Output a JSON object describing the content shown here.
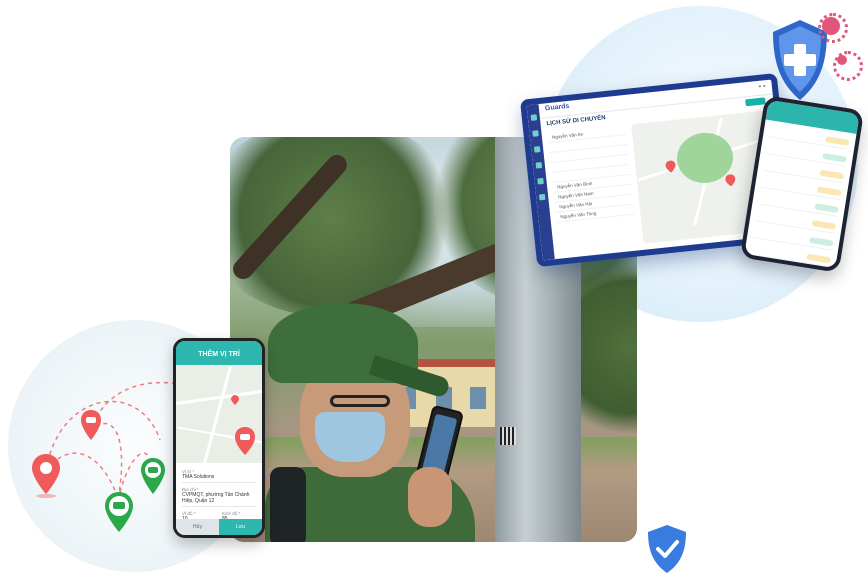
{
  "colors": {
    "brand_teal": "#2db7ae",
    "brand_navy": "#1e3b8f",
    "shield_blue": "#3a7be0",
    "pin_red": "#ef5a5a",
    "pin_green": "#2aa84a"
  },
  "photo": {
    "description_icon": "person-with-phone-photo"
  },
  "dashboard": {
    "logo": "Guards",
    "title": "LỊCH SỬ DI CHUYỂN",
    "list_items": [
      "Nguyễn Văn An",
      "",
      "",
      "",
      "",
      "Nguyễn Văn Bình",
      "Nguyễn Văn Nam",
      "Nguyễn Văn Hải",
      "Nguyễn Văn Tùng"
    ]
  },
  "phone_left": {
    "header": "THÊM VỊ TRÍ",
    "field1_label": "Vị trí *",
    "field1_value": "TMA Solutions",
    "field2_label": "Địa chỉ *",
    "field2_value": "CVPMQT, phường Tân Chánh Hiệp, Quận 12",
    "field3_label": "Vĩ độ *",
    "field3_value": "10",
    "field4_label": "Kinh độ *",
    "field4_value": "85",
    "cancel": "Hủy",
    "save": "Lưu"
  },
  "icons": [
    "shield-plus-icon",
    "virus-icon",
    "shield-check-icon",
    "location-pin-icon",
    "car-pin-icon"
  ]
}
